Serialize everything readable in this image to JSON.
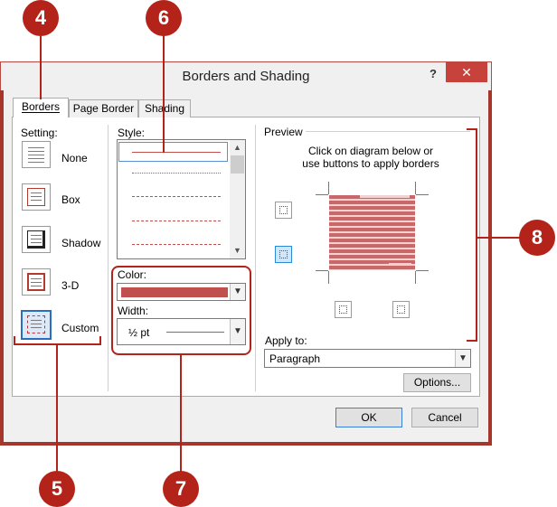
{
  "window": {
    "title": "Borders and Shading",
    "help": "?",
    "close": "✕"
  },
  "tabs": [
    "Borders",
    "Page Border",
    "Shading"
  ],
  "setting": {
    "label": "Setting:",
    "options": [
      "None",
      "Box",
      "Shadow",
      "3-D",
      "Custom"
    ],
    "selected": "Custom"
  },
  "style": {
    "label": "Style:"
  },
  "color": {
    "label": "Color:",
    "value_hex": "#c0504d"
  },
  "width": {
    "label": "Width:",
    "value": "½ pt"
  },
  "preview": {
    "label": "Preview",
    "hint_line1": "Click on diagram below or",
    "hint_line2": "use buttons to apply borders"
  },
  "apply_to": {
    "label": "Apply to:",
    "value": "Paragraph"
  },
  "buttons": {
    "options": "Options...",
    "ok": "OK",
    "cancel": "Cancel"
  },
  "callouts": [
    "4",
    "6",
    "8",
    "5",
    "7"
  ],
  "colors": {
    "accent": "#b3231a",
    "border_red": "#c0504d",
    "selection_blue": "#2a6fbf"
  }
}
